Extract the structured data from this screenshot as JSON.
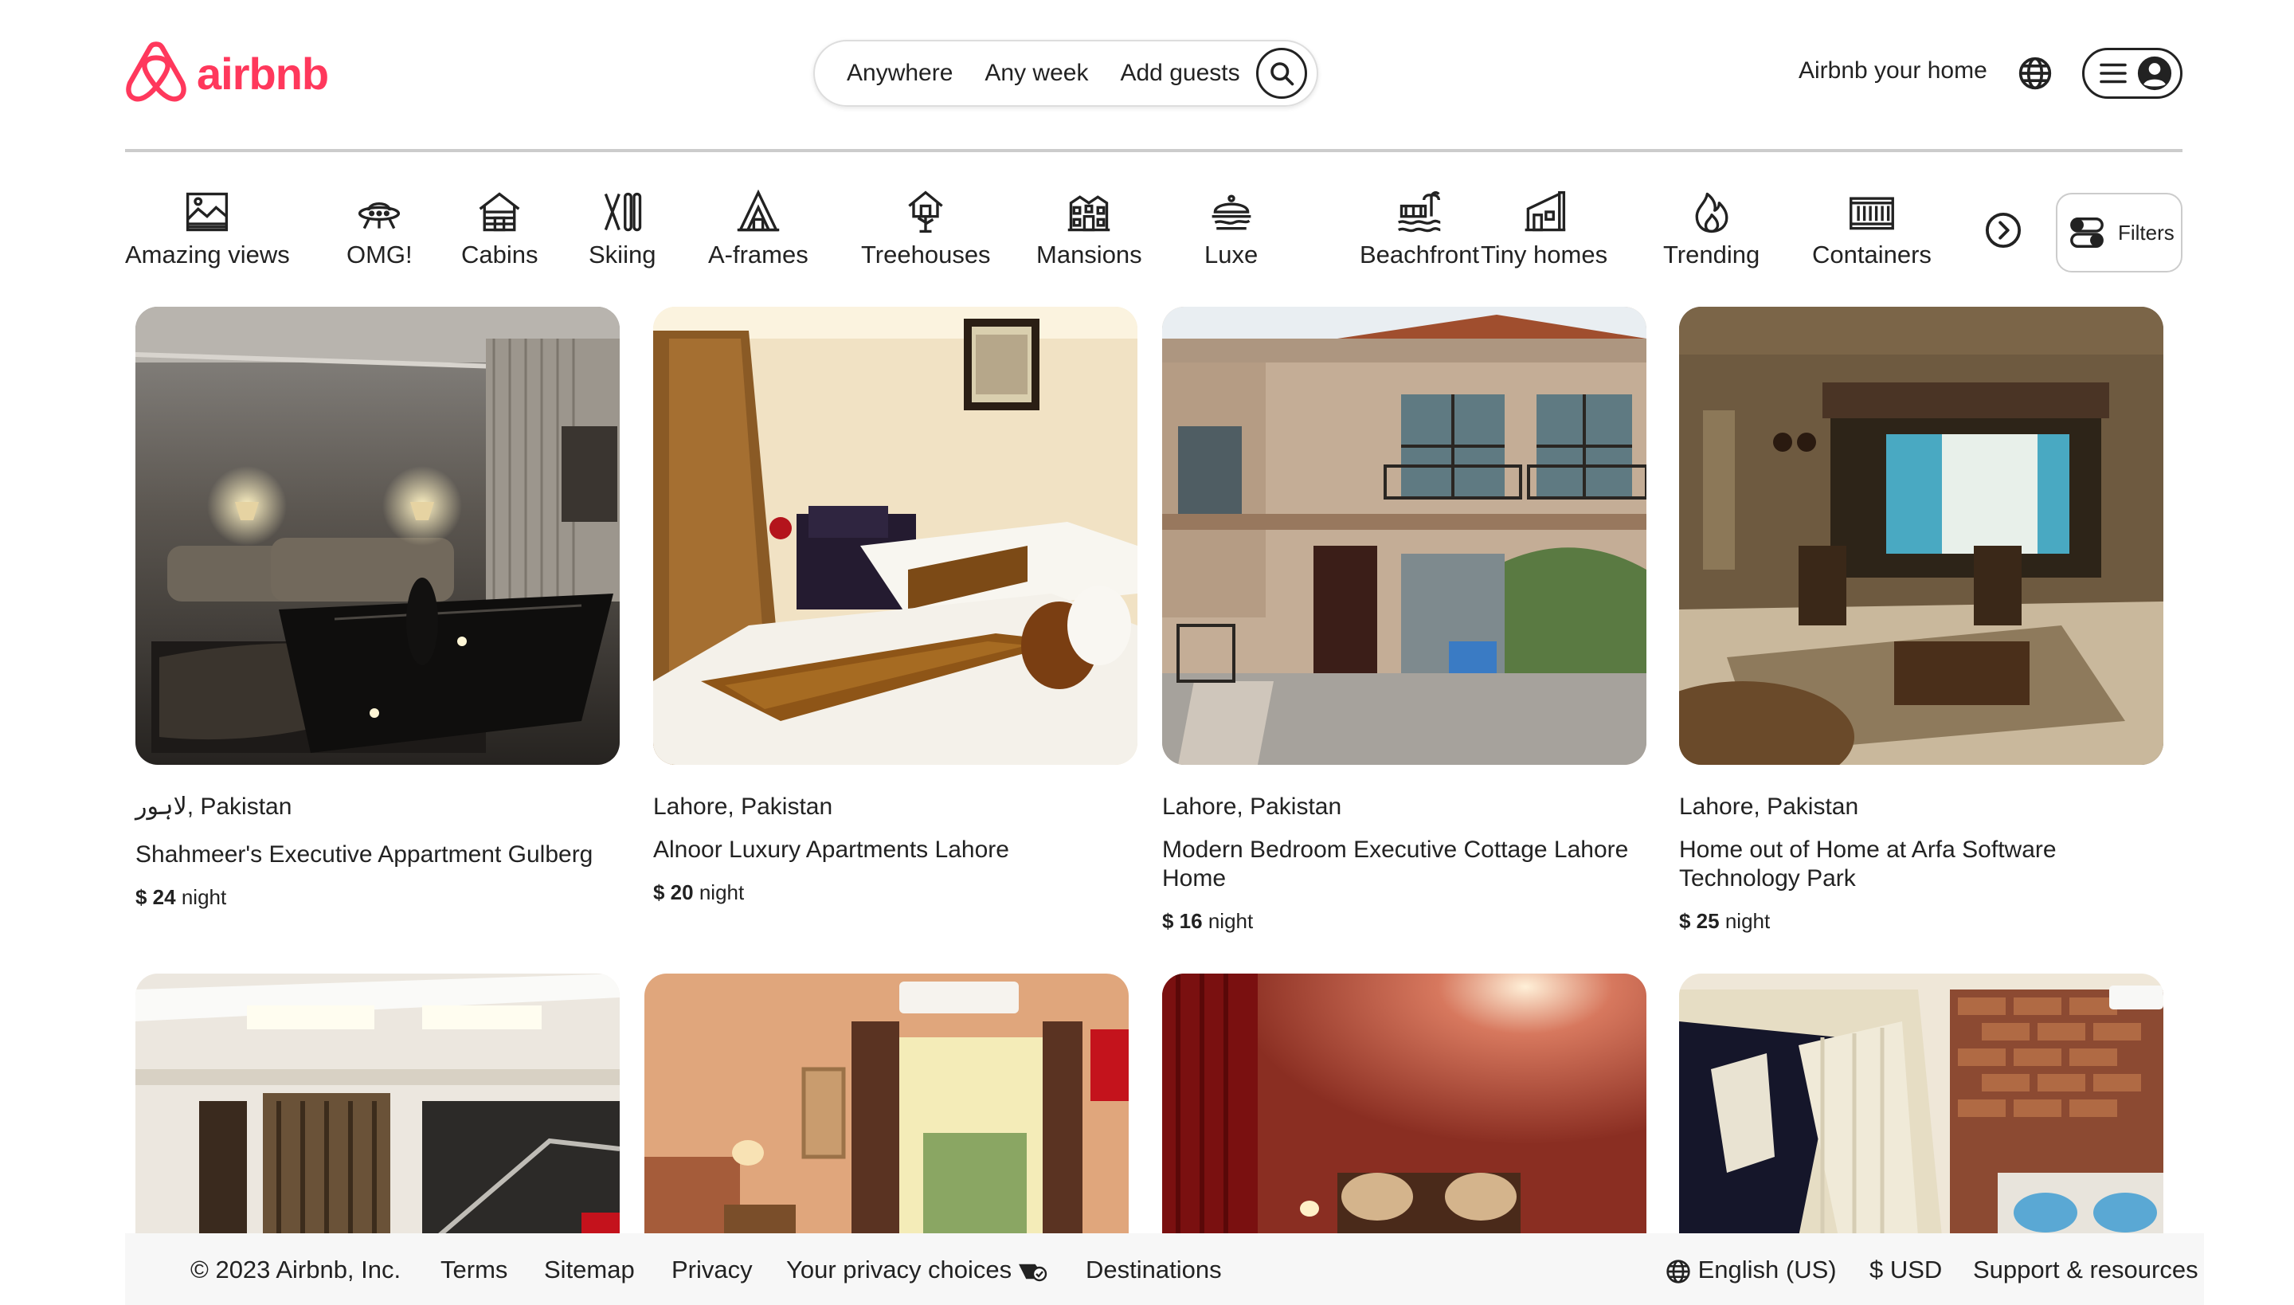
{
  "brand": {
    "name": "airbnb",
    "color": "#ff385c"
  },
  "search": {
    "location": "Anywhere",
    "dates": "Any week",
    "guests": "Add guests"
  },
  "header": {
    "host_link": "Airbnb your home"
  },
  "categories": [
    {
      "label": "Amazing views",
      "icon": "amazing-views-icon"
    },
    {
      "label": "OMG!",
      "icon": "ufo-icon"
    },
    {
      "label": "Cabins",
      "icon": "cabin-icon"
    },
    {
      "label": "Skiing",
      "icon": "skiing-icon"
    },
    {
      "label": "A-frames",
      "icon": "a-frame-icon"
    },
    {
      "label": "Treehouses",
      "icon": "treehouse-icon"
    },
    {
      "label": "Mansions",
      "icon": "mansion-icon"
    },
    {
      "label": "Luxe",
      "icon": "luxe-icon"
    },
    {
      "label": "Beachfront",
      "icon": "beachfront-icon"
    },
    {
      "label": "Tiny homes",
      "icon": "tiny-home-icon"
    },
    {
      "label": "Trending",
      "icon": "flame-icon"
    },
    {
      "label": "Containers",
      "icon": "container-icon"
    }
  ],
  "filters": {
    "label": "Filters"
  },
  "listings": [
    {
      "location": "لاہور, Pakistan",
      "title": "Shahmeer's Executive Appartment Gulberg",
      "price": "$ 24",
      "unit": "night"
    },
    {
      "location": "Lahore, Pakistan",
      "title": "Alnoor Luxury Apartments Lahore",
      "price": "$ 20",
      "unit": "night"
    },
    {
      "location": "Lahore, Pakistan",
      "title": "Modern Bedroom Executive Cottage Lahore Home",
      "price": "$ 16",
      "unit": "night"
    },
    {
      "location": "Lahore, Pakistan",
      "title": "Home out of Home at Arfa Software Technology Park",
      "price": "$ 25",
      "unit": "night"
    }
  ],
  "footer": {
    "copyright": "© 2023 Airbnb, Inc.",
    "links": [
      "Terms",
      "Sitemap",
      "Privacy",
      "Your privacy choices",
      "Destinations"
    ],
    "language": "English (US)",
    "currency": "$ USD",
    "support": "Support & resources"
  }
}
